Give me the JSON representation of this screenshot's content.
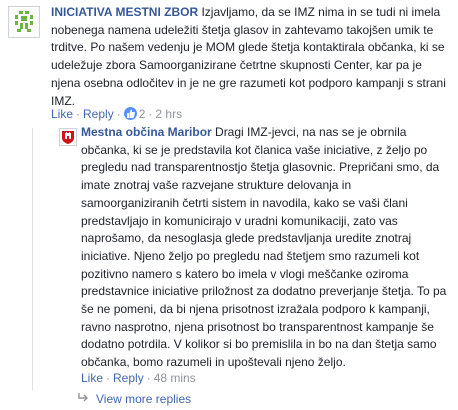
{
  "comment1": {
    "author": "INICIATIVA MESTNI ZBOR",
    "text": " Izjavljamo, da se IMZ nima in se tudi ni imela nobenega namena udeležiti štetja glasov in zahtevamo takojšen umik te trditve. Po našem vedenju je MOM glede štetja kontaktirala občanka, ki se udeležuje zbora Samoorganizirane četrtne skupnosti Center, kar pa je njena osebna odločitev in je ne gre razumeti kot podporo kampanji s strani IMZ.",
    "like_label": "Like",
    "reply_label": "Reply",
    "reactions_count": "2",
    "timestamp": "2 hrs"
  },
  "comment2": {
    "author": "Mestna občina Maribor",
    "text": " Dragi IMZ-jevci, na nas se je obrnila občanka, ki se je predstavila kot članica vaše iniciative, z željo po pregledu nad transparentnostjo štetja glasovnic. Prepričani smo, da imate znotraj vaše razvejane strukture delovanja in samoorganiziranih četrti sistem in navodila, kako se vaši člani predstavljajo in komunicirajo v uradni komunikaciji, zato vas naprošamo, da nesoglasja glede predstavljanja uredite znotraj iniciative. Njeno željo po pregledu nad štetjem smo razumeli kot pozitivno namero s katero bo imela v vlogi meščanke oziroma predstavnice iniciative priložnost za dodatno preverjanje štetja. To pa še ne pomeni, da bi njena prisotnost izražala podporo k kampanji, ravno nasprotno, njena prisotnost bo transparentnost kampanje še dodatno potrdila. V kolikor si bo premislila in bo na dan štetja samo občanka, bomo razumeli in upoštevali njeno željo.",
    "like_label": "Like",
    "reply_label": "Reply",
    "timestamp": "48 mins"
  },
  "view_more_label": "View more replies",
  "colors": {
    "link": "#365899",
    "action": "#4267b2",
    "meta": "#90949c",
    "logo_green": "#6cb33f",
    "crest_red": "#d0121b"
  },
  "icons": {
    "avatar1": "initiative-logo-icon",
    "avatar2": "maribor-crest-icon",
    "reaction": "like-thumb-icon",
    "view_more": "reply-arrow-icon"
  }
}
